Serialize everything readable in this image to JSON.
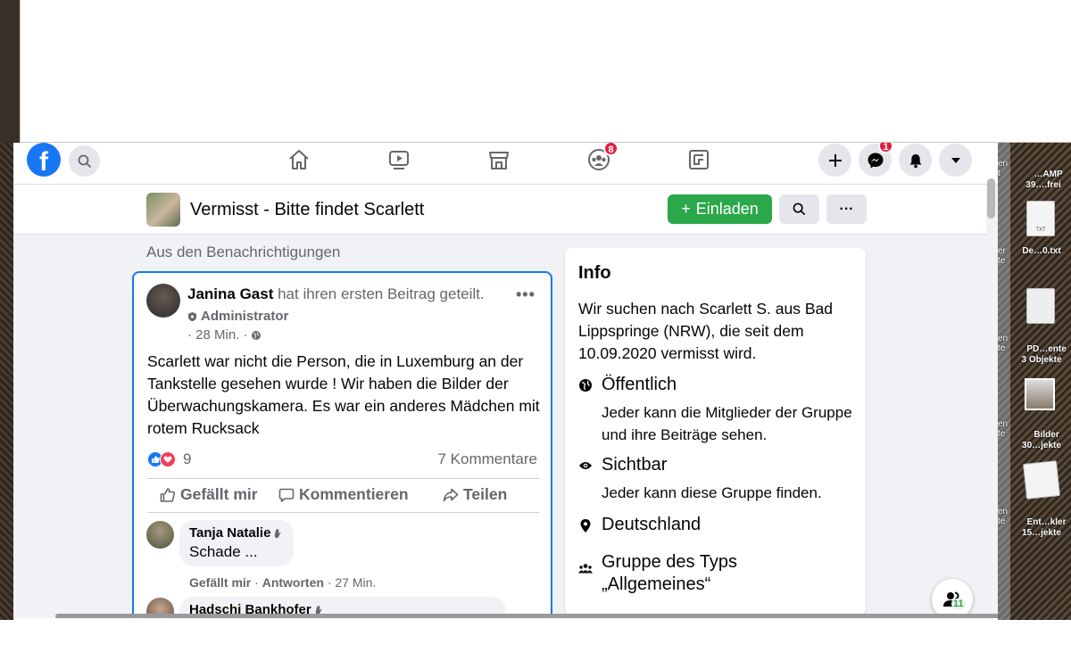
{
  "desktop": {
    "items": [
      {
        "label": "…AMP\n39….frei"
      },
      {
        "label": "De…0.txt",
        "file_tag": "TXT"
      },
      {
        "label": "PD…ente\n3 Objekte"
      },
      {
        "label": "Bilder\n30…jekte"
      },
      {
        "label": "Ent…kler\n15…jekte"
      }
    ],
    "fragments": [
      "en\nt",
      "er\nte",
      "en\nte",
      "en\nte",
      "en\nte"
    ]
  },
  "topnav": {
    "logo_letter": "f",
    "groups_badge": "8",
    "messenger_badge": "1"
  },
  "group": {
    "name": "Vermisst - Bitte findet Scarlett",
    "invite_plus": "+",
    "invite_label": "Einladen",
    "more": "···"
  },
  "feed": {
    "section_label": "Aus den Benachrichtigungen",
    "post": {
      "author": "Janina Gast",
      "action": " hat ihren ersten Beitrag geteilt.",
      "more": "•••",
      "role": "Administrator",
      "time": "· 28 Min. ·",
      "text": "Scarlett war nicht die Person,  die in Luxemburg an der Tankstelle gesehen wurde ! Wir haben die Bilder der Überwachungskamera. Es war ein anderes Mädchen mit rotem Rucksack",
      "reaction_count": "9",
      "comment_count": "7 Kommentare",
      "like_label": "Gefällt mir",
      "comment_label": "Kommentieren",
      "share_label": "Teilen"
    },
    "comments": [
      {
        "name": "Tanja Natalie",
        "text": "Schade ...",
        "like": "Gefällt mir",
        "reply": "Antworten",
        "time": "· 27 Min."
      },
      {
        "name": "Hadschi Bankhofer"
      }
    ]
  },
  "info": {
    "title": "Info",
    "description": "Wir suchen nach Scarlett S. aus Bad Lippspringe (NRW), die seit dem 10.09.2020 vermisst wird.",
    "rows": [
      {
        "heading": "Öffentlich",
        "detail": "Jeder kann die Mitglieder der Gruppe und ihre Beiträge sehen."
      },
      {
        "heading": "Sichtbar",
        "detail": "Jeder kann diese Gruppe finden."
      },
      {
        "heading": "Deutschland",
        "detail": ""
      },
      {
        "heading": "Gruppe des Typs „Allgemeines“",
        "detail": ""
      }
    ]
  },
  "chat": {
    "online_count": "11"
  },
  "colors": {
    "brand_blue": "#1877f2",
    "invite_green": "#2ba84a",
    "badge_red": "#e41e3f",
    "background": "#f0f2f5"
  }
}
